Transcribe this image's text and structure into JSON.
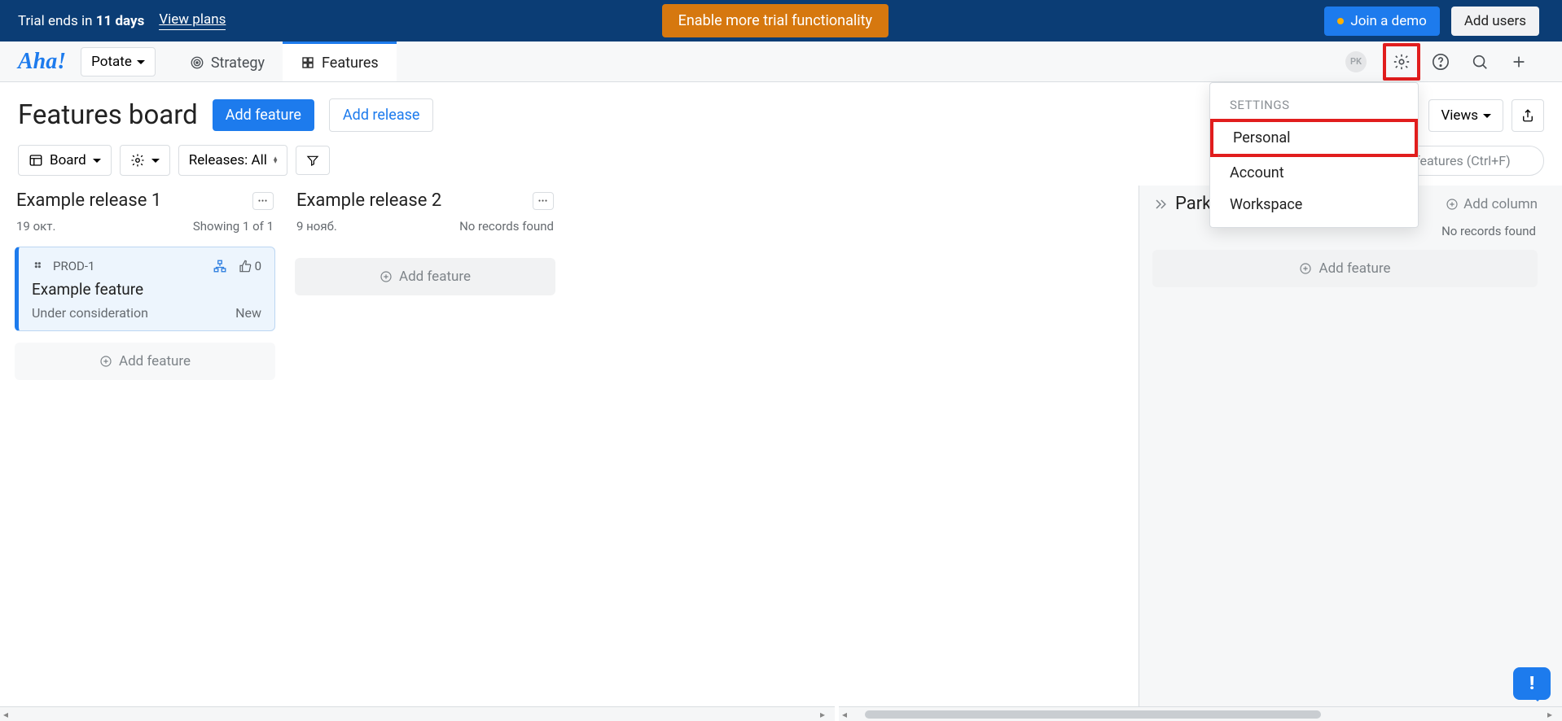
{
  "trial": {
    "prefix": "Trial ends in ",
    "days": "11 days",
    "view_plans": "View plans",
    "enable": "Enable more trial functionality",
    "join_demo": "Join a demo",
    "add_users": "Add users"
  },
  "nav": {
    "logo": "Aha!",
    "workspace": "Potate",
    "tabs": {
      "strategy": "Strategy",
      "features": "Features"
    },
    "avatar": "PK"
  },
  "head": {
    "title": "Features board",
    "add_feature": "Add feature",
    "add_release": "Add release",
    "views": "Views"
  },
  "toolbar": {
    "board": "Board",
    "releases": "Releases: All",
    "search_placeholder": "Search features (Ctrl+F)"
  },
  "settings_menu": {
    "header": "SETTINGS",
    "items": [
      "Personal",
      "Account",
      "Workspace"
    ]
  },
  "columns": [
    {
      "title": "Example release 1",
      "date": "19 окт.",
      "meta_right": "Showing 1 of 1",
      "cards": [
        {
          "ref": "PROD-1",
          "votes": "0",
          "title": "Example feature",
          "status": "Under consideration",
          "tag": "New"
        }
      ],
      "add_label": "Add feature"
    },
    {
      "title": "Example release 2",
      "date": "9 нояб.",
      "meta_right": "No records found",
      "cards": [],
      "add_label": "Add feature"
    }
  ],
  "parking": {
    "title": "Parking",
    "add_column": "Add column",
    "no_records": "No records found",
    "add_feature": "Add feature"
  }
}
